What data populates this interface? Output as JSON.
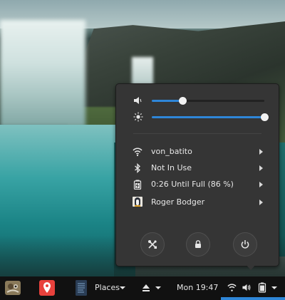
{
  "system_menu": {
    "volume": {
      "level": 0.27,
      "icon": "volume-low-icon"
    },
    "brightness": {
      "level": 1.0,
      "icon": "brightness-icon"
    },
    "items": [
      {
        "label": "von_batito",
        "icon": "wifi-icon"
      },
      {
        "label": "Not In Use",
        "icon": "bluetooth-icon"
      },
      {
        "label": "0:26 Until Full (86 %)",
        "icon": "battery-charging-icon"
      },
      {
        "label": "Roger Bodger",
        "icon": "user-avatar-icon"
      }
    ],
    "buttons": [
      {
        "name": "settings-button",
        "icon": "settings-tools-icon"
      },
      {
        "name": "lock-button",
        "icon": "lock-icon"
      },
      {
        "name": "power-button",
        "icon": "power-icon"
      }
    ]
  },
  "panel": {
    "places_label": "Places",
    "clock": "Mon 19:47",
    "apps": [
      "gimp-icon",
      "maps-icon",
      "document-viewer-icon"
    ],
    "status_icons": [
      "eject-icon",
      "wifi-icon",
      "volume-icon",
      "battery-icon"
    ]
  },
  "colors": {
    "accent": "#2e86d8",
    "menu_bg": "#353535",
    "panel_bg": "#111111"
  }
}
